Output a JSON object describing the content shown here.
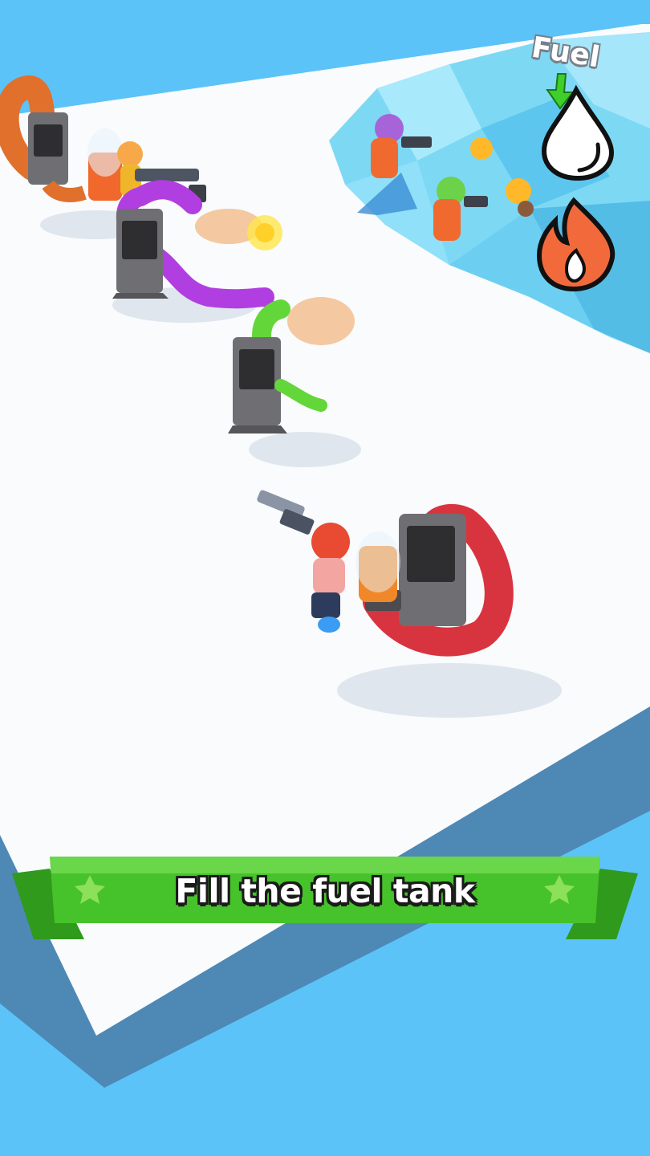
{
  "hud": {
    "fuel_label": "Fuel",
    "indicators": [
      {
        "name": "fuel-drop-icon",
        "color": "#ffffff"
      },
      {
        "name": "fire-icon",
        "color": "#f26a3c"
      }
    ],
    "arrow_color": "#3ecf2a"
  },
  "banner": {
    "text": "Fill the fuel tank",
    "color": "#45c42a",
    "icons": [
      "star-icon",
      "star-icon"
    ]
  },
  "colors": {
    "water": "#5bc3f8",
    "ice": "#7dd8f4",
    "floor": "#ffffff",
    "machine": "#6f6f73"
  }
}
